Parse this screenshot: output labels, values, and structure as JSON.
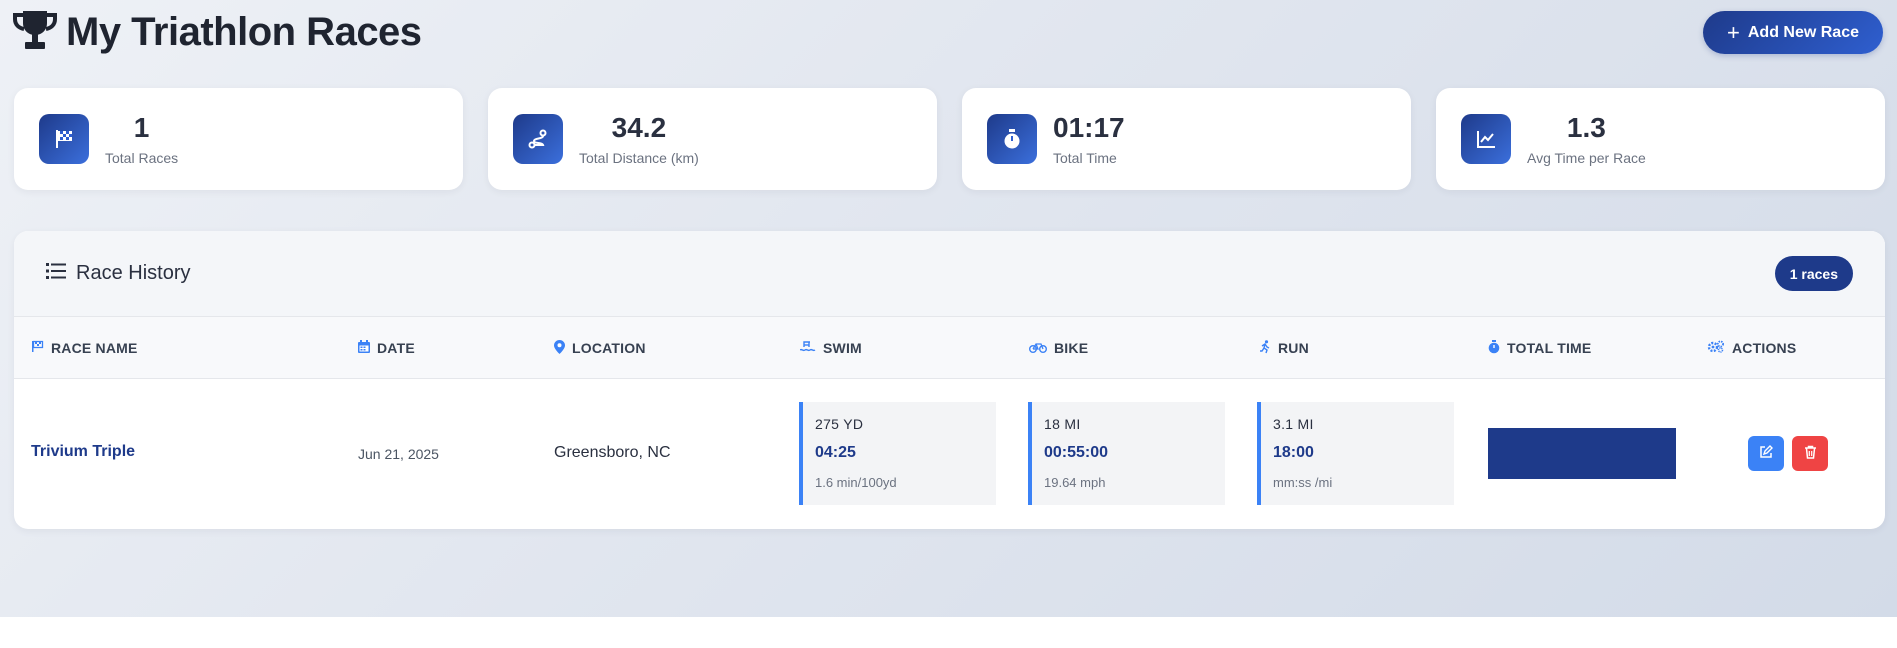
{
  "header": {
    "title": "My Triathlon Races",
    "add_button_label": "Add New Race",
    "title_icon": "trophy-icon",
    "add_icon": "plus-icon"
  },
  "stats": [
    {
      "icon": "checkered-flag-icon",
      "value": "1",
      "label": "Total Races"
    },
    {
      "icon": "route-icon",
      "value": "34.2",
      "label": "Total Distance (km)"
    },
    {
      "icon": "stopwatch-icon",
      "value": "01:17",
      "label": "Total Time"
    },
    {
      "icon": "chart-line-icon",
      "value": "1.3",
      "label": "Avg Time per Race"
    }
  ],
  "history": {
    "title": "Race History",
    "count_badge": "1 races",
    "columns": {
      "race_name": "RACE NAME",
      "date": "DATE",
      "location": "LOCATION",
      "swim": "SWIM",
      "bike": "BIKE",
      "run": "RUN",
      "total_time": "TOTAL TIME",
      "actions": "ACTIONS"
    },
    "rows": [
      {
        "name": "Trivium Triple",
        "date": "Jun 21, 2025",
        "location": "Greensboro, NC",
        "swim": {
          "distance": "275 YD",
          "time": "04:25",
          "pace": "1.6 min/100yd"
        },
        "bike": {
          "distance": "18 MI",
          "time": "00:55:00",
          "pace": "19.64 mph"
        },
        "run": {
          "distance": "3.1 MI",
          "time": "18:00",
          "pace": "mm:ss /mi"
        }
      }
    ]
  },
  "colors": {
    "primary": "#1e3a8a",
    "accent": "#3b82f6",
    "danger": "#ef4444"
  }
}
